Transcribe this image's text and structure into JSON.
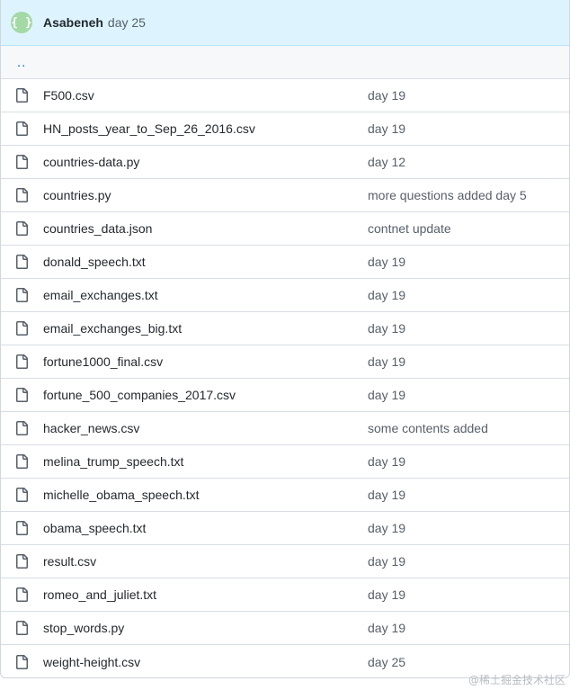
{
  "header": {
    "avatar_glyph": "{ }",
    "author": "Asabeneh",
    "message": "day 25"
  },
  "parent_dir": "..",
  "files": [
    {
      "name": "F500.csv",
      "message": "day 19",
      "icon": "file-icon"
    },
    {
      "name": "HN_posts_year_to_Sep_26_2016.csv",
      "message": "day 19",
      "icon": "file-icon"
    },
    {
      "name": "countries-data.py",
      "message": "day 12",
      "icon": "file-icon"
    },
    {
      "name": "countries.py",
      "message": "more questions added day 5",
      "icon": "file-icon"
    },
    {
      "name": "countries_data.json",
      "message": "contnet update",
      "icon": "file-icon"
    },
    {
      "name": "donald_speech.txt",
      "message": "day 19",
      "icon": "file-icon"
    },
    {
      "name": "email_exchanges.txt",
      "message": "day 19",
      "icon": "file-icon"
    },
    {
      "name": "email_exchanges_big.txt",
      "message": "day 19",
      "icon": "file-icon"
    },
    {
      "name": "fortune1000_final.csv",
      "message": "day 19",
      "icon": "file-icon"
    },
    {
      "name": "fortune_500_companies_2017.csv",
      "message": "day 19",
      "icon": "file-icon"
    },
    {
      "name": "hacker_news.csv",
      "message": "some contents added",
      "icon": "file-icon"
    },
    {
      "name": "melina_trump_speech.txt",
      "message": "day 19",
      "icon": "file-icon"
    },
    {
      "name": "michelle_obama_speech.txt",
      "message": "day 19",
      "icon": "file-icon"
    },
    {
      "name": "obama_speech.txt",
      "message": "day 19",
      "icon": "file-icon"
    },
    {
      "name": "result.csv",
      "message": "day 19",
      "icon": "file-icon"
    },
    {
      "name": "romeo_and_juliet.txt",
      "message": "day 19",
      "icon": "file-icon"
    },
    {
      "name": "stop_words.py",
      "message": "day 19",
      "icon": "file-icon"
    },
    {
      "name": "weight-height.csv",
      "message": "day 25",
      "icon": "file-icon"
    }
  ],
  "watermark": "@稀土掘金技术社区",
  "colors": {
    "header_bg": "#ddf4ff",
    "link": "#0969da",
    "muted": "#57606a",
    "avatar": "#a3d9a5"
  }
}
